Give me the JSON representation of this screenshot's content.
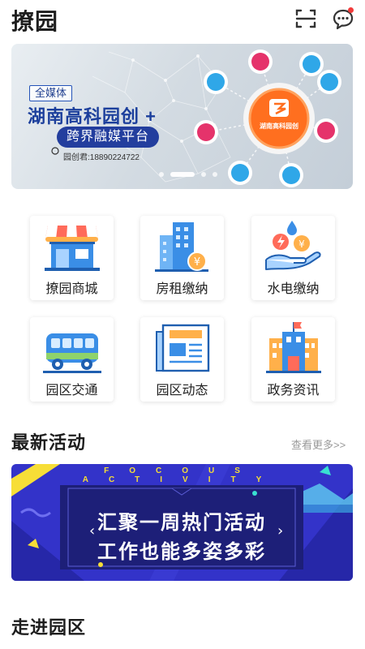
{
  "app": {
    "title": "撩园"
  },
  "header": {
    "scan_icon": "scan-icon",
    "message_icon": "message-icon",
    "has_unread": true
  },
  "banner": {
    "tag": "全媒体",
    "title": "湖南高科园创 +",
    "pill": "跨界融媒平台",
    "phone": "园创君:18890224722",
    "hub_label": "湖南高科园创",
    "slide_count": 4,
    "active_slide": 0
  },
  "services": [
    {
      "label": "撩园商城",
      "icon": "shop-icon"
    },
    {
      "label": "房租缴纳",
      "icon": "building-rent-icon"
    },
    {
      "label": "水电缴纳",
      "icon": "utilities-payment-icon"
    },
    {
      "label": "园区交通",
      "icon": "bus-icon"
    },
    {
      "label": "园区动态",
      "icon": "news-icon"
    },
    {
      "label": "政务资讯",
      "icon": "government-building-icon"
    }
  ],
  "activities": {
    "title": "最新活动",
    "more": "查看更多>>",
    "banner_header": "FOCOUS ACTIVITY",
    "line1": "汇聚一周热门活动",
    "line2": "工作也能多姿多彩"
  },
  "park_section": {
    "title": "走进园区"
  },
  "colors": {
    "accent_blue": "#2d6fd6",
    "activity_bg": "#3333c9",
    "activity_yellow": "#f7de37",
    "badge_red": "#f23b3b"
  }
}
